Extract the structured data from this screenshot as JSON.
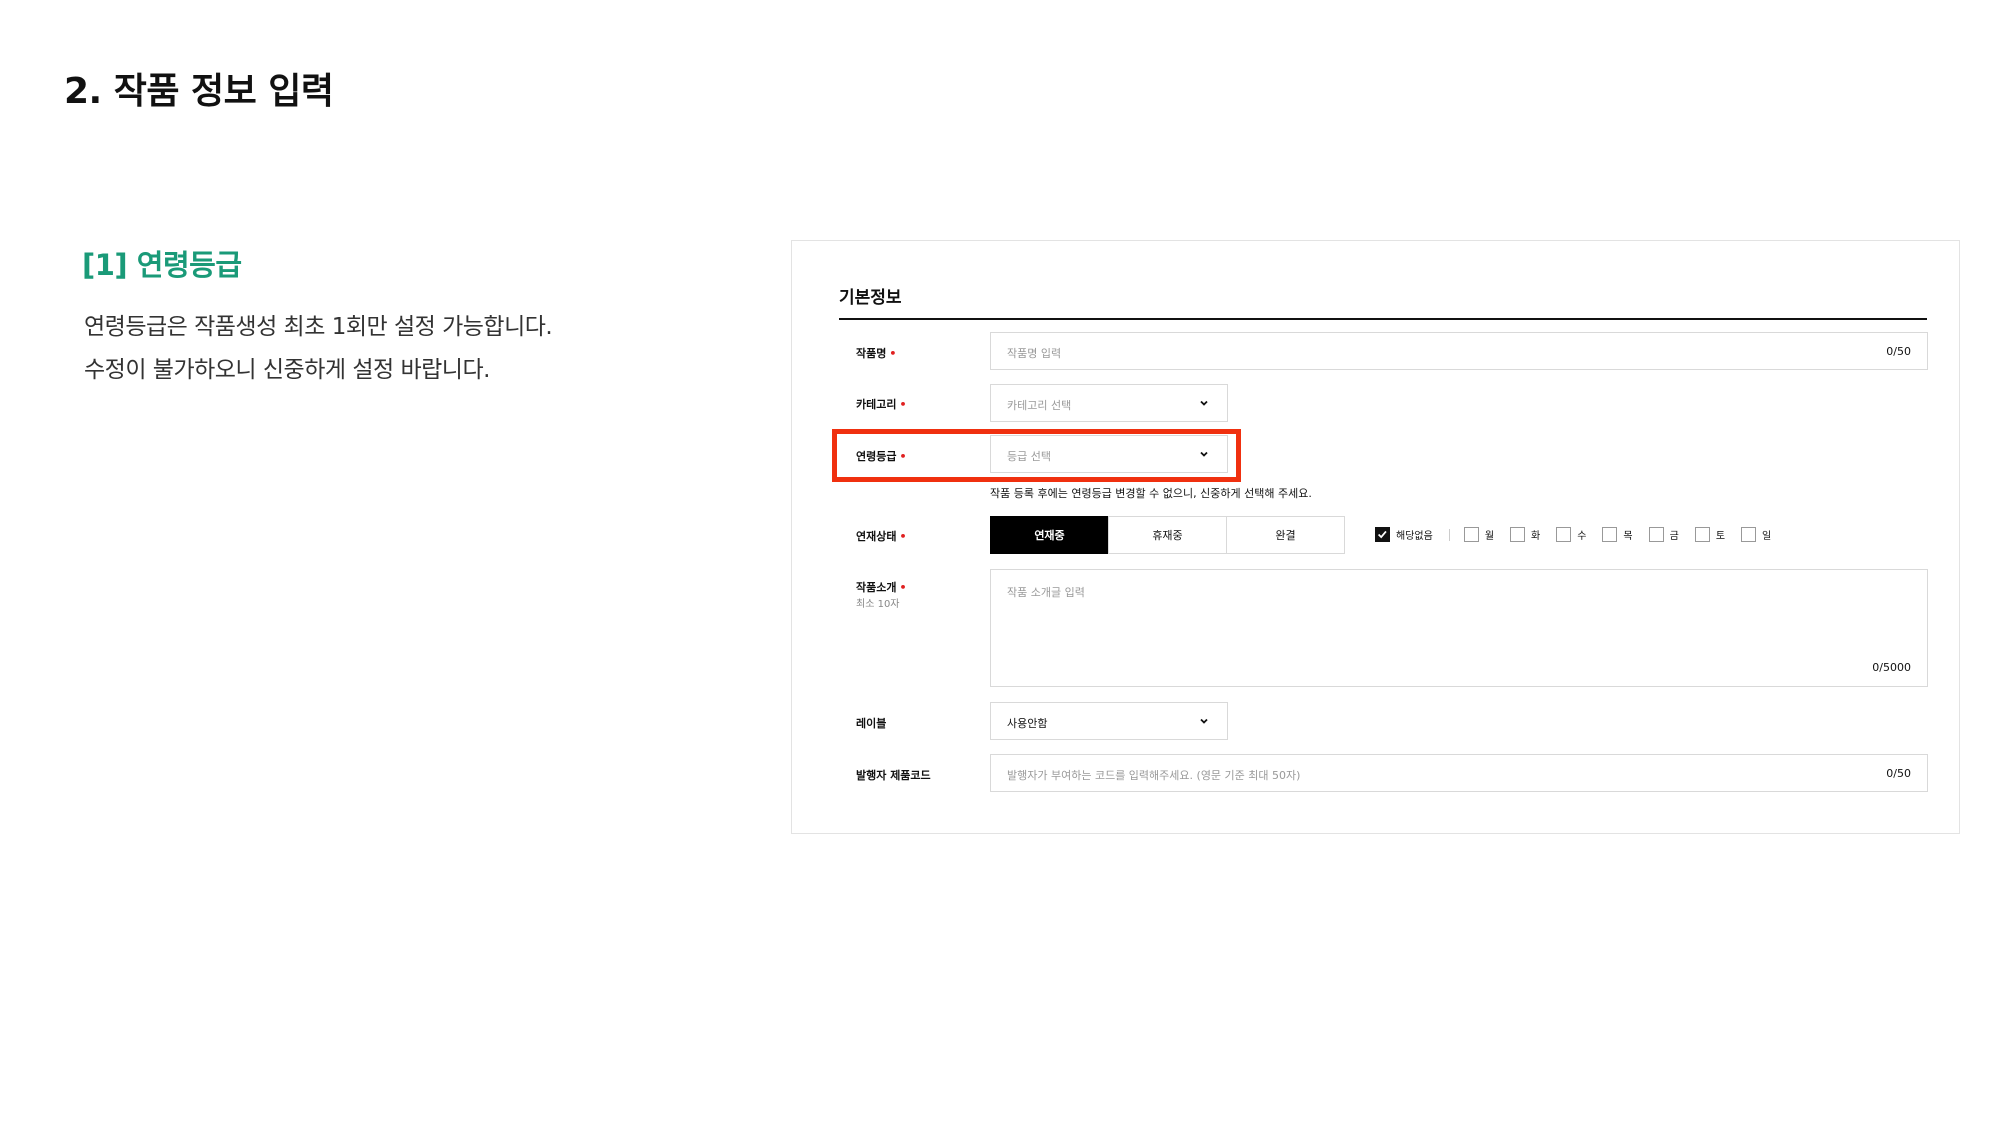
{
  "page": {
    "title": "2. 작품 정보 입력"
  },
  "section": {
    "heading": "[1] 연령등급",
    "desc_line1": "연령등급은 작품생성 최초 1회만 설정 가능합니다.",
    "desc_line2": "수정이 불가하오니 신중하게 설정 바랍니다."
  },
  "form": {
    "title": "기본정보",
    "required_mark": "•",
    "title_field": {
      "label": "작품명",
      "placeholder": "작품명 입력",
      "count": "0/50"
    },
    "category": {
      "label": "카테고리",
      "placeholder": "카테고리 선택"
    },
    "age_rating": {
      "label": "연령등급",
      "placeholder": "등급 선택",
      "helper": "작품 등록 후에는 연령등급 변경할 수 없으니, 신중하게 선택해 주세요."
    },
    "serial_status": {
      "label": "연재상태",
      "options": [
        "연재중",
        "휴재중",
        "완결"
      ],
      "selected": "연재중"
    },
    "days": {
      "none_label": "해당없음",
      "none_checked": true,
      "items": [
        "월",
        "화",
        "수",
        "목",
        "금",
        "토",
        "일"
      ]
    },
    "intro": {
      "label": "작품소개",
      "sub_label": "최소 10자",
      "placeholder": "작품 소개글 입력",
      "count": "0/5000"
    },
    "label_field": {
      "label": "레이블",
      "value": "사용안함"
    },
    "product_code": {
      "label": "발행자 제품코드",
      "placeholder": "발행자가 부여하는 코드를 입력해주세요. (영문 기준 최대 50자)",
      "count": "0/50"
    }
  },
  "colors": {
    "accent": "#1a9a78",
    "highlight": "#f0300f",
    "required": "#e02020"
  },
  "icons": {
    "select_arrow": "chevron-down-icon",
    "check": "checkmark-icon"
  }
}
